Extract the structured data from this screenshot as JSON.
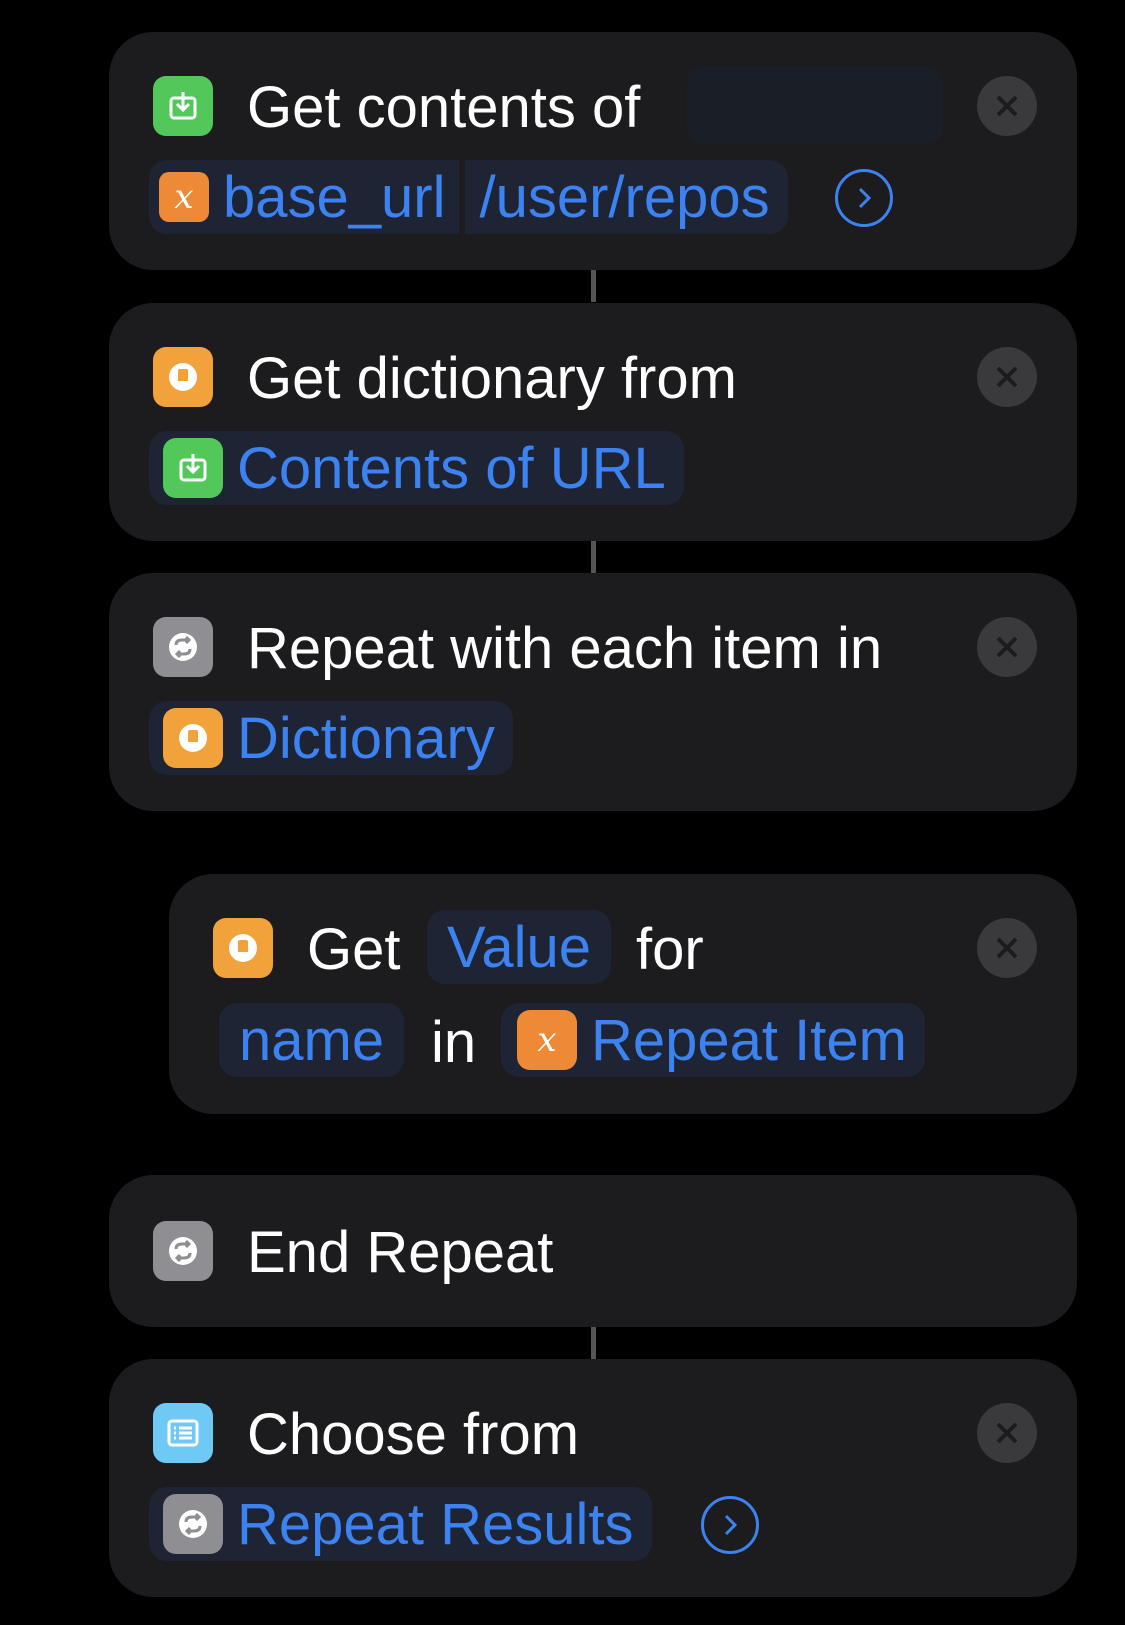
{
  "actions": {
    "get_contents": {
      "title": "Get contents of",
      "variable_label": "base_url",
      "path_label": "/user/repos",
      "icon": "download-icon",
      "close": "close-icon",
      "expand": "chevron-right-icon"
    },
    "get_dictionary": {
      "title": "Get dictionary from",
      "param_label": "Contents of URL",
      "icon": "book-icon"
    },
    "repeat": {
      "title": "Repeat with each item in",
      "param_label": "Dictionary",
      "icon": "repeat-icon"
    },
    "get_value": {
      "word_get": "Get",
      "value_label": "Value",
      "word_for": "for",
      "key_label": "name",
      "word_in": "in",
      "item_label": "Repeat Item"
    },
    "end_repeat": {
      "title": "End Repeat"
    },
    "choose_from": {
      "title": "Choose from",
      "param_label": "Repeat Results",
      "icon": "list-icon"
    }
  },
  "colors": {
    "background": "#000000",
    "card": "#1c1c1e",
    "accent_blue": "#3c82f0",
    "green": "#52c85b",
    "orange": "#f2a23a",
    "grey": "#8e8e93",
    "cyan": "#6fc9f5"
  }
}
